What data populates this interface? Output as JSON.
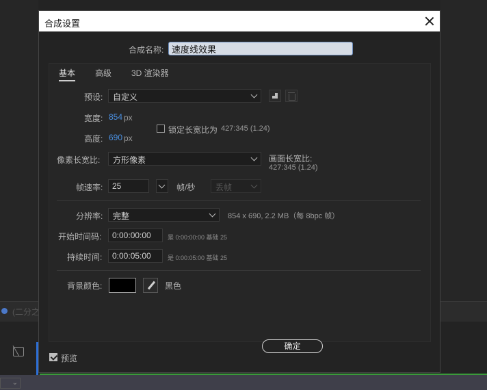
{
  "dialog": {
    "title": "合成设置",
    "comp_name_label": "合成名称:",
    "comp_name_value": "速度线效果"
  },
  "tabs": [
    {
      "label": "基本",
      "active": true
    },
    {
      "label": "高级",
      "active": false
    },
    {
      "label": "3D 渲染器",
      "active": false
    }
  ],
  "preset": {
    "label": "预设:",
    "value": "自定义"
  },
  "width": {
    "label": "宽度:",
    "value": "854",
    "unit": "px"
  },
  "height": {
    "label": "高度:",
    "value": "690",
    "unit": "px"
  },
  "lock_aspect": {
    "label": "锁定长宽比为",
    "value": "427:345 (1.24)",
    "checked": false
  },
  "pixel_aspect": {
    "label": "像素长宽比:",
    "value": "方形像素"
  },
  "frame_aspect": {
    "label": "画面长宽比:",
    "value": "427:345 (1.24)"
  },
  "frame_rate": {
    "label": "帧速率:",
    "value": "25",
    "unit": "帧/秒",
    "drop_frame": "丢帧"
  },
  "resolution": {
    "label": "分辨率:",
    "value": "完整",
    "info": "854 x 690, 2.2 MB（每 8bpc 帧）"
  },
  "start_timecode": {
    "label": "开始时间码:",
    "value": "0:00:00:00",
    "note": "是 0:00:00:00  基础 25"
  },
  "duration": {
    "label": "持续时间:",
    "value": "0:00:05:00",
    "note": "是 0:00:05:00  基础 25"
  },
  "background_color": {
    "label": "背景颜色:",
    "name": "黑色",
    "color": "#000000"
  },
  "preview": {
    "label": "预览",
    "checked": true
  },
  "ok_button": "确定",
  "background_app": {
    "strip_text": "(二分之",
    "mini_select": "⌄"
  }
}
